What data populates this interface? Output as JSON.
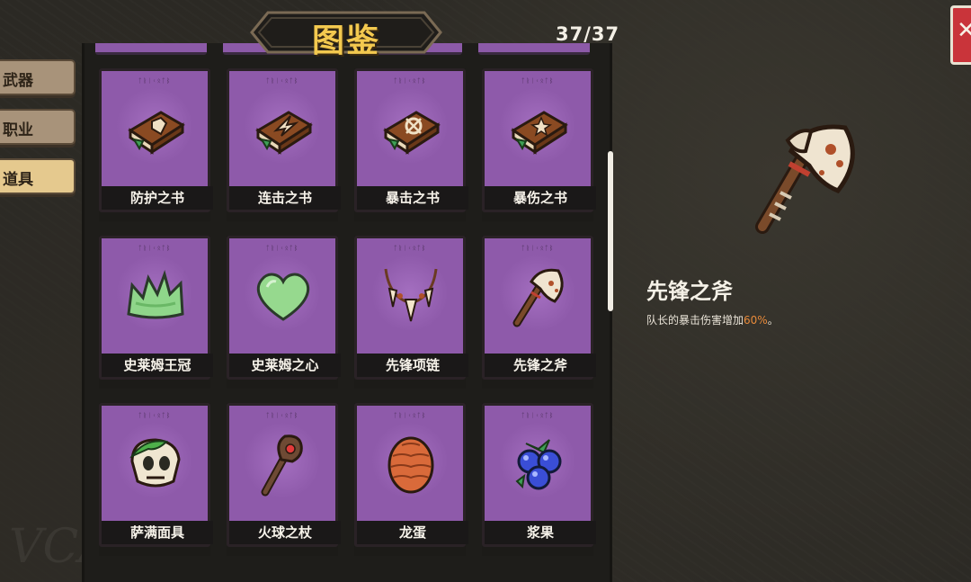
{
  "header": {
    "title": "图鉴",
    "counter": "37/37",
    "close_icon": "close-icon"
  },
  "tabs": [
    {
      "label": "武器",
      "active": false
    },
    {
      "label": "职业",
      "active": false
    },
    {
      "label": "道具",
      "active": true
    }
  ],
  "items": [
    {
      "name": "防护之书",
      "icon": "book-shield-icon"
    },
    {
      "name": "连击之书",
      "icon": "book-strike-icon"
    },
    {
      "name": "暴击之书",
      "icon": "book-crosshair-icon"
    },
    {
      "name": "暴伤之书",
      "icon": "book-star-icon"
    },
    {
      "name": "史莱姆王冠",
      "icon": "slime-crown-icon"
    },
    {
      "name": "史莱姆之心",
      "icon": "slime-heart-icon"
    },
    {
      "name": "先锋项链",
      "icon": "fang-necklace-icon"
    },
    {
      "name": "先锋之斧",
      "icon": "axe-icon"
    },
    {
      "name": "萨满面具",
      "icon": "shaman-mask-icon"
    },
    {
      "name": "火球之杖",
      "icon": "fire-staff-icon"
    },
    {
      "name": "龙蛋",
      "icon": "dragon-egg-icon"
    },
    {
      "name": "浆果",
      "icon": "berry-icon"
    }
  ],
  "detail": {
    "name": "先锋之斧",
    "desc_prefix": "队长的暴击伤害增加",
    "desc_value": "60%",
    "desc_suffix": "。",
    "icon": "axe-icon"
  },
  "watermark": "VCANU",
  "colors": {
    "card_purple": "#8e5aaa",
    "title_gold": "#f3c94f",
    "highlight_orange": "#e88a3a",
    "close_red": "#c9343a",
    "tab_active": "#e5c98e",
    "tab_inactive": "#a8937a"
  }
}
